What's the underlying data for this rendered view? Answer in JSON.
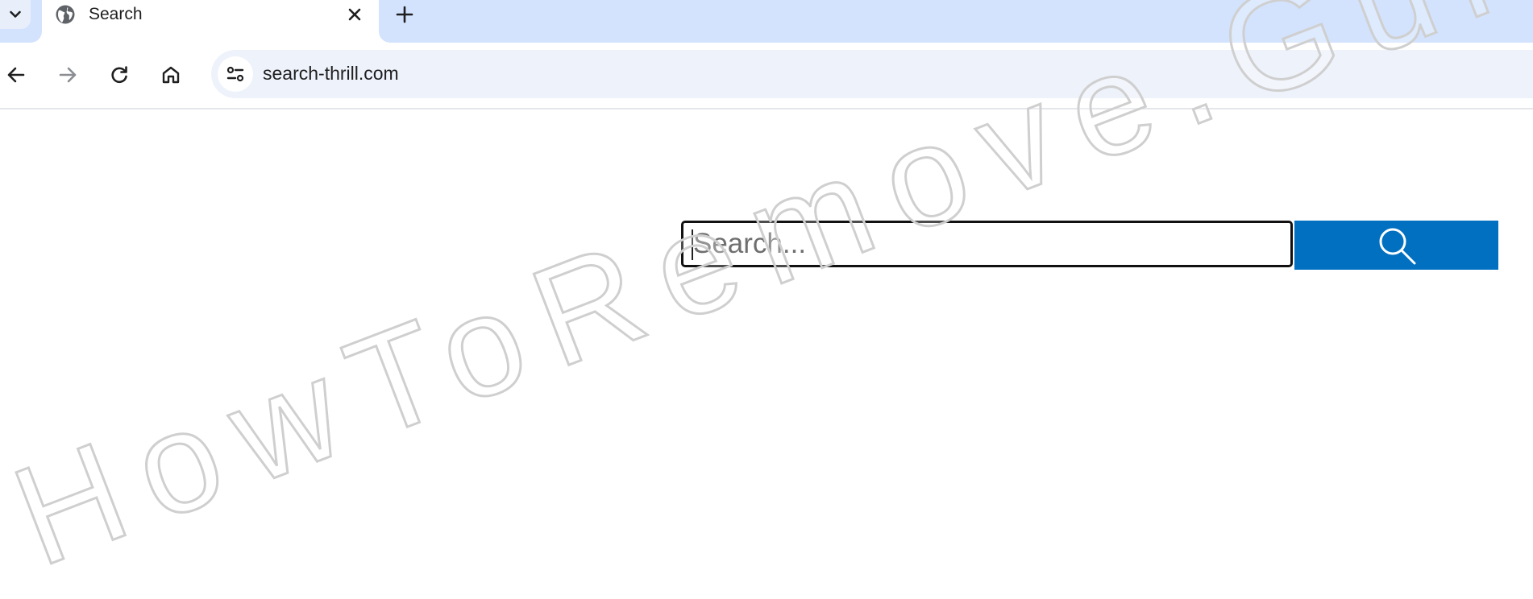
{
  "tab_strip": {
    "tab_list_icon": "chevron-down-icon",
    "active_tab": {
      "favicon": "globe-icon",
      "title": "Search",
      "close_icon": "close-icon"
    },
    "new_tab_icon": "plus-icon",
    "background_color": "#d3e3fd"
  },
  "toolbar": {
    "back_icon": "arrow-left-icon",
    "forward_icon": "arrow-right-icon",
    "reload_icon": "reload-icon",
    "home_icon": "home-icon",
    "site_info_icon": "tune-icon",
    "url": "search-thrill.com"
  },
  "page": {
    "search": {
      "placeholder": "Search...",
      "value": ""
    },
    "search_button_icon": "magnifier-icon",
    "accent_color": "#0270c0"
  },
  "watermark": {
    "text": "HowToRemove.Guide"
  }
}
